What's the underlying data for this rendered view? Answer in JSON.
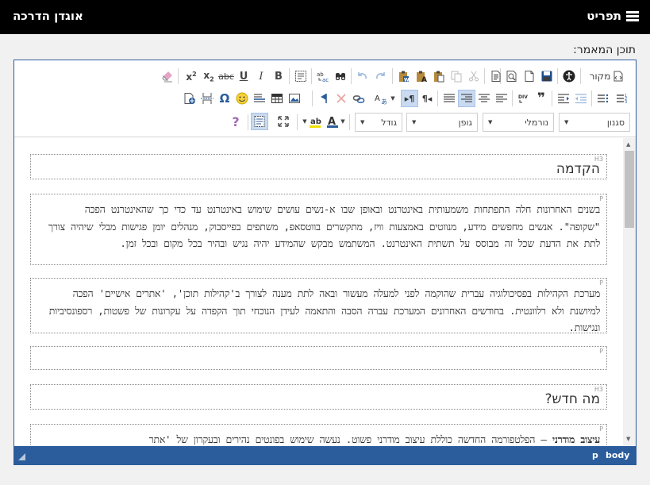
{
  "topbar": {
    "menu_label": "תפריט",
    "title": "אוגדן הדרכה"
  },
  "field": {
    "label": "תוכן המאמר:"
  },
  "toolbar": {
    "source_label": "מקור",
    "combos": {
      "styles": "סגנון",
      "format": "נורמלי",
      "font": "גופן",
      "size": "גודל"
    }
  },
  "content": {
    "blocks": [
      {
        "tag": "H3",
        "text": "הקדמה"
      },
      {
        "tag": "P",
        "text": "בשנים האחרונות חלה התפתחות משמעותית באינטרנט ובאופן שבו א-נשים עושים שימוש באינטרנט עד כדי כך שהאינטרנט הפכה \"שקופה\". אנשים מחפשים מידע, מנווטים באמצעות וויז, מתקשרים בווטסאפ, משתפים בפייסבוק, מנהלים יומן פגישות מבלי שיהיה צורך לתת את הדעת שכל זה מבוסס על תשתית האינטרנט. המשתמש מבקש שהמידע יהיה נגיש ובהיר בכל מקום ובכל זמן."
      },
      {
        "tag": "P",
        "text": "מערכת הקהילות בפסיכולוגיה עברית שהוקמה לפני למעלה מעשור ובאה לתת מענה לצורך ב'קהילות תוכן', 'אתרים אישיים' הפכה למיושנת ולא רלוונטית. בחודשים האחרונים המערכת עברה הסבה והתאמה לעידן הנוכחי תוך הקפדה על עקרונות של פשטות, רספונסיביות ונגישות."
      },
      {
        "tag": "P",
        "text": ""
      },
      {
        "tag": "H3",
        "text": "מה חדש?"
      },
      {
        "tag": "P",
        "bold": "עיצוב מודרני",
        "text": " – הפלטפורמה החדשה כוללת עיצוב מודרני פשוט. נעשה שימוש בפונטים נהירים ובעקרון של 'אתר"
      }
    ]
  },
  "statusbar": {
    "path_body": "body",
    "path_p": "p"
  },
  "colors": {
    "accent": "#2b5d9c",
    "topbar": "#000000"
  },
  "icons": [
    "menu-icon",
    "source-icon",
    "accessibility-icon",
    "save-icon",
    "new-page-icon",
    "preview-icon",
    "templates-icon",
    "cut-icon",
    "copy-icon",
    "paste-icon",
    "paste-text-icon",
    "paste-word-icon",
    "redo-icon",
    "undo-icon",
    "find-icon",
    "replace-icon",
    "select-all-icon",
    "bold-icon",
    "italic-icon",
    "underline-icon",
    "strike-icon",
    "subscript-icon",
    "superscript-icon",
    "remove-format-icon",
    "numbered-list-icon",
    "bulleted-list-icon",
    "outdent-icon",
    "indent-icon",
    "blockquote-icon",
    "div-icon",
    "align-left-icon",
    "align-center-icon",
    "align-right-icon",
    "justify-icon",
    "bidi-ltr-icon",
    "bidi-rtl-icon",
    "language-icon",
    "link-icon",
    "unlink-icon",
    "anchor-icon",
    "image-icon",
    "table-icon",
    "horizontal-rule-icon",
    "smiley-icon",
    "special-char-icon",
    "page-break-icon",
    "iframe-icon",
    "text-color-icon",
    "bg-color-icon",
    "maximize-icon",
    "show-blocks-icon",
    "about-icon"
  ]
}
